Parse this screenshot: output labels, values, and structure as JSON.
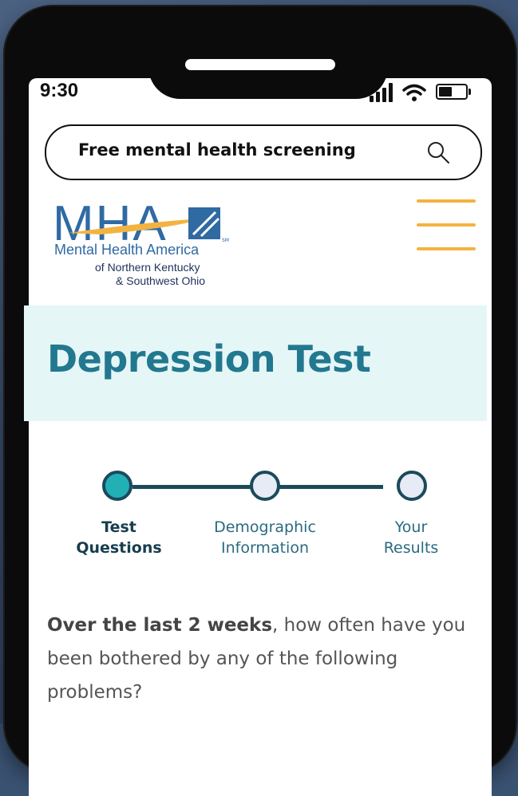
{
  "status_bar": {
    "time": "9:30"
  },
  "search": {
    "text": "Free mental health screening",
    "icon": "search-icon"
  },
  "logo": {
    "letters": "MHA",
    "name": "Mental Health America",
    "region_line1": "of Northern Kentucky",
    "region_line2": "& Southwest Ohio",
    "sm": "SM"
  },
  "menu": {
    "icon": "hamburger-menu-icon",
    "color": "#f3b340"
  },
  "hero": {
    "title": "Depression Test",
    "bg": "#e5f6f7",
    "title_color": "#22788f"
  },
  "stepper": {
    "steps": [
      {
        "line1": "Test",
        "line2": "Questions",
        "state": "active"
      },
      {
        "line1": "Demographic",
        "line2": "Information",
        "state": "inactive"
      },
      {
        "line1": "Your",
        "line2": "Results",
        "state": "inactive"
      }
    ],
    "active_color": "#22b0b7",
    "line_color": "#1b4a5b"
  },
  "question": {
    "bold": "Over the last 2 weeks",
    "rest": ", how often have you been bothered by any of the following problems?"
  }
}
